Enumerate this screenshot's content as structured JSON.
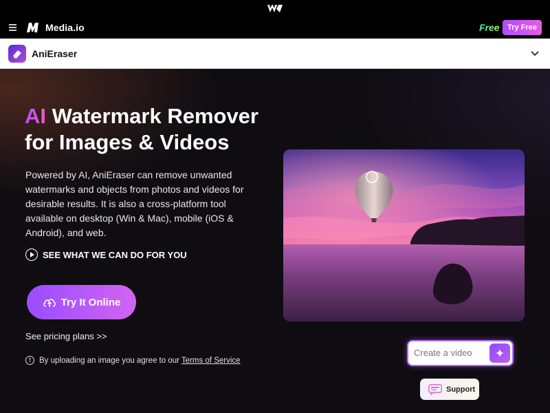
{
  "top_strip": {
    "logo_icon": "wondershare-logo-icon"
  },
  "media_bar": {
    "brand": "Media.io",
    "free_label": "Free",
    "try_free_label": "Try Free",
    "menu_icon": "hamburger-icon"
  },
  "product_bar": {
    "name": "AniEraser",
    "expand_icon": "chevron-down-icon"
  },
  "hero": {
    "title_accent": "AI",
    "title_rest": " Watermark Remover for Images & Videos",
    "description": "Powered by AI, AniEraser can remove unwanted watermarks and objects from photos and videos for desirable results. It is also a cross-platform tool available on desktop (Win & Mac), mobile (iOS & Android), and web.",
    "see_what_label": "SEE WHAT WE CAN DO FOR YOU",
    "try_online_label": "Try It Online",
    "pricing_link": "See pricing plans >>",
    "upload_note_prefix": "By uploading an image you agree to our ",
    "terms_link": "Terms of Service"
  },
  "widget": {
    "create_placeholder": "Create a video",
    "support_label": "Support"
  },
  "colors": {
    "accent_purple": "#9a4dff",
    "accent_pink": "#d264f2",
    "free_green": "#3bf0b4"
  }
}
